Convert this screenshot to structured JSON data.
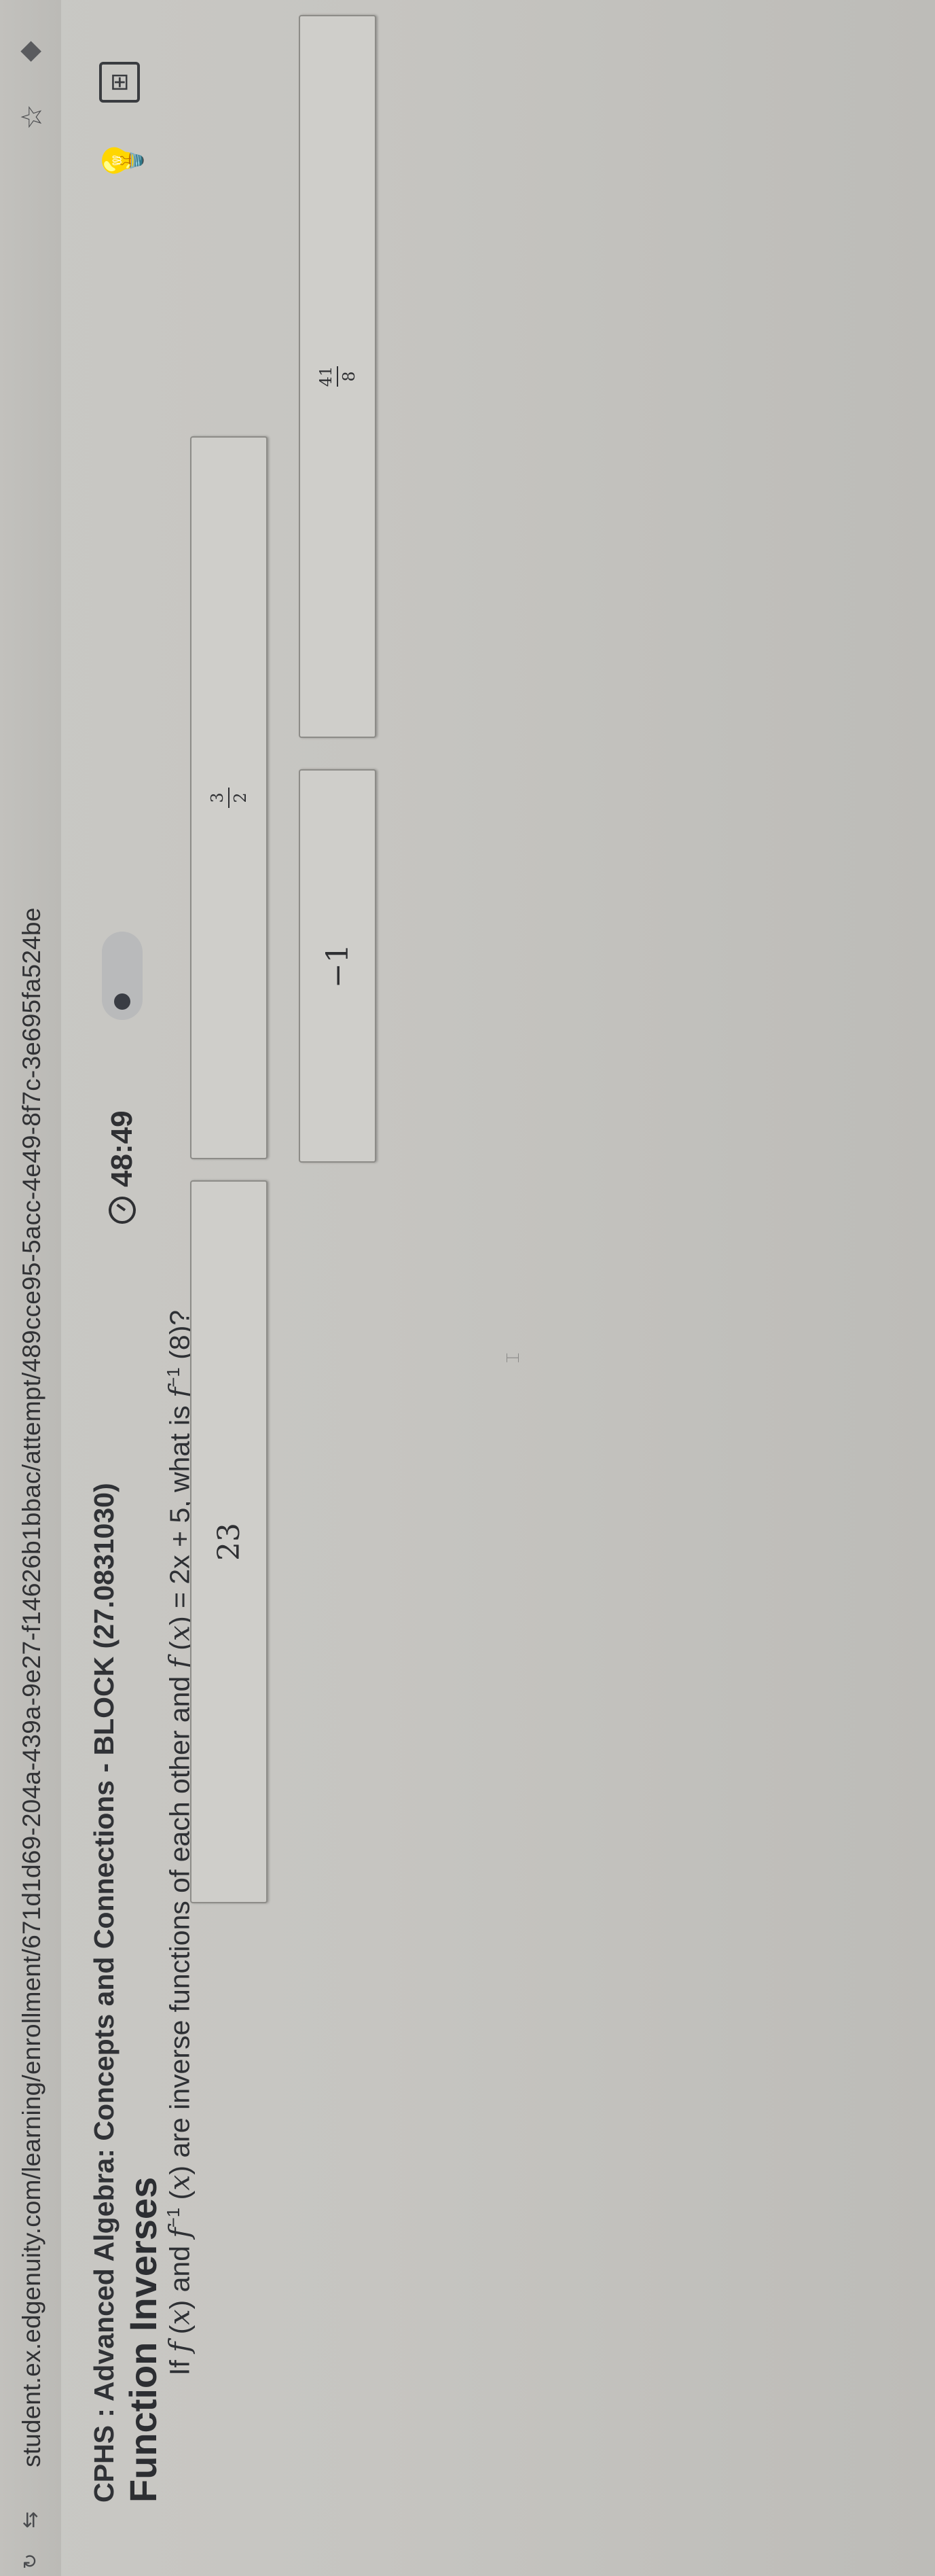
{
  "browser": {
    "url": "student.ex.edgenuity.com/learning/enrollment/671d1d69-204a-439a-9e27-f14626b1bbac/attempt/489cce95-5acc-4e49-8f7c-3e695fa524be"
  },
  "header": {
    "breadcrumb": "CPHS : Advanced Algebra: Concepts and Connections - BLOCK (27.0831030)",
    "title": "Function Inverses",
    "timer": "48:49"
  },
  "question": {
    "prefix": "If ",
    "f1": "f",
    "x1": "x",
    "mid1": ") and ",
    "f2": "f",
    "sup_minus1_a": "−1",
    "x2": "x",
    "mid2": ") are inverse functions of each other and ",
    "f3": "f",
    "x3": "x",
    "eq": ") = 2x + 5, what is ",
    "f4": "f",
    "sup_minus1_b": "−1",
    "arg": " (8)?"
  },
  "choices": [
    {
      "id": "a",
      "num": "3",
      "den": "2"
    },
    {
      "id": "b",
      "value": "23"
    },
    {
      "id": "c",
      "num": "41",
      "den": "8"
    },
    {
      "id": "d",
      "value": "−1"
    }
  ],
  "icons": {
    "address_bar": [
      "back-icon",
      "tune-icon",
      "star-icon",
      "extension-icon"
    ],
    "toolbar": [
      "timer-icon",
      "hint-bulb-icon",
      "calculator-icon"
    ]
  }
}
